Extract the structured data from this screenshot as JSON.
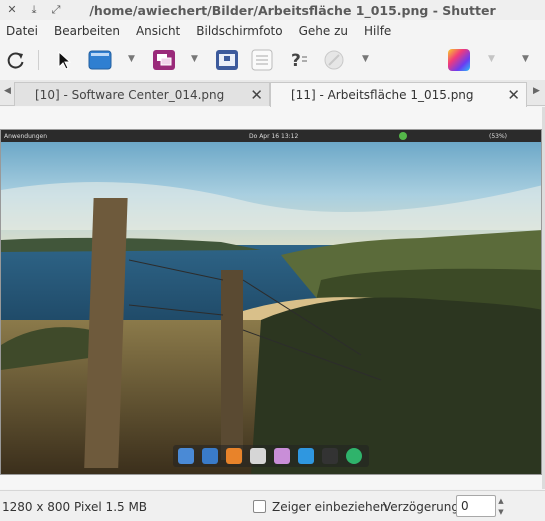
{
  "window": {
    "title": "/home/awiechert/Bilder/Arbeitsfläche 1_015.png - Shutter"
  },
  "menubar": {
    "items": [
      "Datei",
      "Bearbeiten",
      "Ansicht",
      "Bildschirmfoto",
      "Gehe zu",
      "Hilfe"
    ]
  },
  "toolbar": {
    "tools": [
      {
        "name": "refresh-icon"
      },
      {
        "name": "selection-cursor-icon"
      },
      {
        "name": "desktop-screen-icon"
      },
      {
        "name": "window-capture-icon"
      },
      {
        "name": "menu-capture-icon"
      },
      {
        "name": "list-icon"
      },
      {
        "name": "tooltip-question-icon"
      },
      {
        "name": "disabled-circle-icon"
      },
      {
        "name": "edit-palette-icon"
      }
    ]
  },
  "tabs": [
    {
      "label": "[10] - Software Center_014.png",
      "active": false
    },
    {
      "label": "[11] - Arbeitsfläche 1_015.png",
      "active": true
    }
  ],
  "screenshot": {
    "panel_left": "Anwendungen",
    "panel_center": "Do Apr 16  13:12",
    "panel_battery": "(53%)"
  },
  "status": {
    "size_text": "1280 x 800 Pixel  1.5 MB",
    "include_cursor_label": "Zeiger einbeziehen",
    "include_cursor_checked": false,
    "delay_label": "Verzögerung:",
    "delay_value": "0"
  },
  "colors": {
    "window_bg": "#f4f4f4",
    "tab_active_bg": "#f6f6f6",
    "panel_bg": "#2b2b2b"
  }
}
